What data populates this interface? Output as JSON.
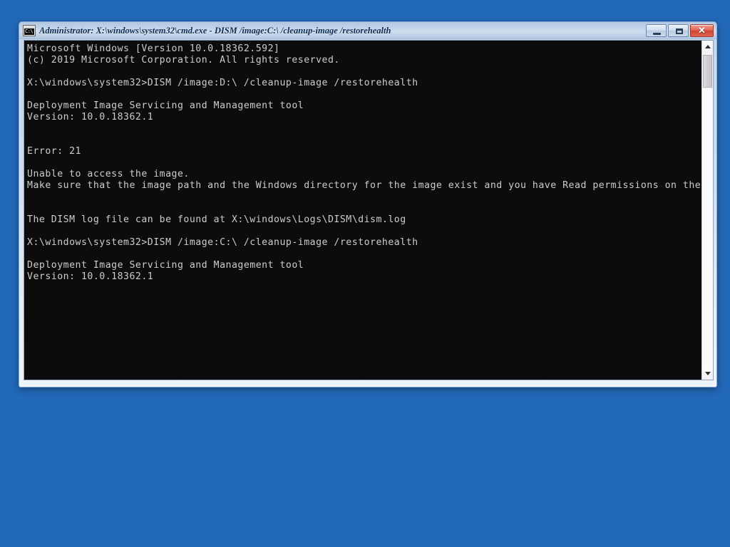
{
  "desktop": {
    "background_color": "#2268b8"
  },
  "window": {
    "title": "Administrator: X:\\windows\\system32\\cmd.exe - DISM  /image:C:\\ /cleanup-image /restorehealth",
    "icon": "cmd-prompt-icon",
    "icon_text": "C:\\",
    "controls": {
      "minimize_label": "Minimize",
      "maximize_label": "Maximize",
      "close_label": "✕",
      "close_color": "#cf4530"
    },
    "title_bar_color": "#bed0e7",
    "client_background_color": "#0c0c0c",
    "client_text_color": "#cccccc"
  },
  "console": {
    "lines": [
      "Microsoft Windows [Version 10.0.18362.592]",
      "(c) 2019 Microsoft Corporation. All rights reserved.",
      "",
      "X:\\windows\\system32>DISM /image:D:\\ /cleanup-image /restorehealth",
      "",
      "Deployment Image Servicing and Management tool",
      "Version: 10.0.18362.1",
      "",
      "",
      "Error: 21",
      "",
      "Unable to access the image.",
      "Make sure that the image path and the Windows directory for the image exist and you have Read permissions on the folder.",
      "",
      "",
      "The DISM log file can be found at X:\\windows\\Logs\\DISM\\dism.log",
      "",
      "X:\\windows\\system32>DISM /image:C:\\ /cleanup-image /restorehealth",
      "",
      "Deployment Image Servicing and Management tool",
      "Version: 10.0.18362.1"
    ]
  },
  "scrollbar": {
    "up_arrow": "scroll-up-arrow",
    "down_arrow": "scroll-down-arrow",
    "thumb": "scroll-thumb"
  }
}
